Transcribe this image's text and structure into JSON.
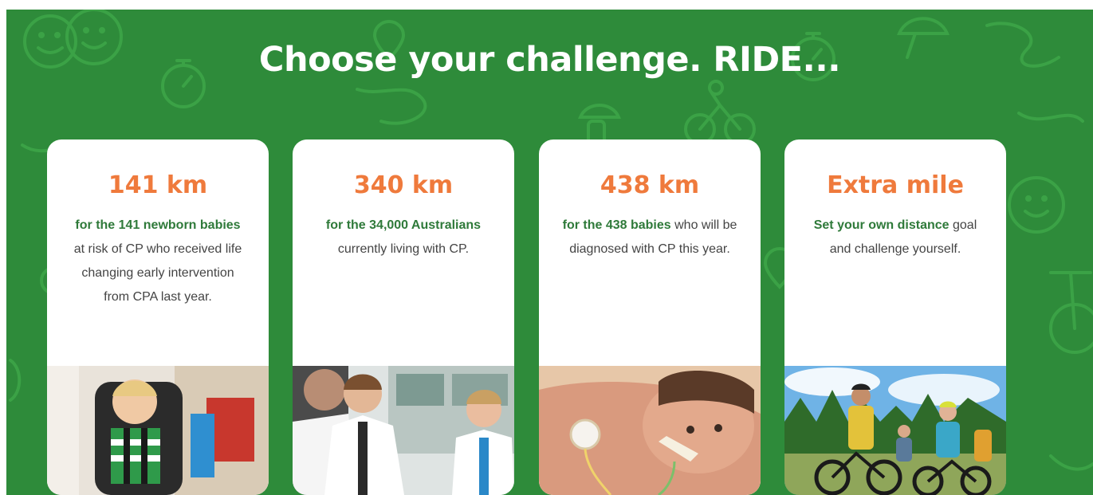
{
  "page": {
    "title": "Choose your challenge. RIDE...",
    "background_color": "#2e8b3a"
  },
  "colors": {
    "accent_orange": "#ef7a3c",
    "highlight_green": "#2f7a3a",
    "body_text": "#444444",
    "card_bg": "#ffffff"
  },
  "cards": [
    {
      "distance": "141 km",
      "highlight": "for the 141 newborn babies",
      "rest": " at risk of CP who received life changing early intervention from CPA last year.",
      "photo_icon": "child-in-wheelchair-photo"
    },
    {
      "distance": "340 km",
      "highlight": "for the 34,000 Australians",
      "rest": " currently living with CP.",
      "photo_icon": "medical-staff-photo"
    },
    {
      "distance": "438 km",
      "highlight": "for the 438 babies",
      "rest": " who will be diagnosed with CP this year.",
      "photo_icon": "newborn-baby-photo"
    },
    {
      "distance": "Extra mile",
      "highlight": "Set your own distance",
      "rest": " goal and challenge yourself.",
      "photo_icon": "family-cycling-photo"
    }
  ]
}
